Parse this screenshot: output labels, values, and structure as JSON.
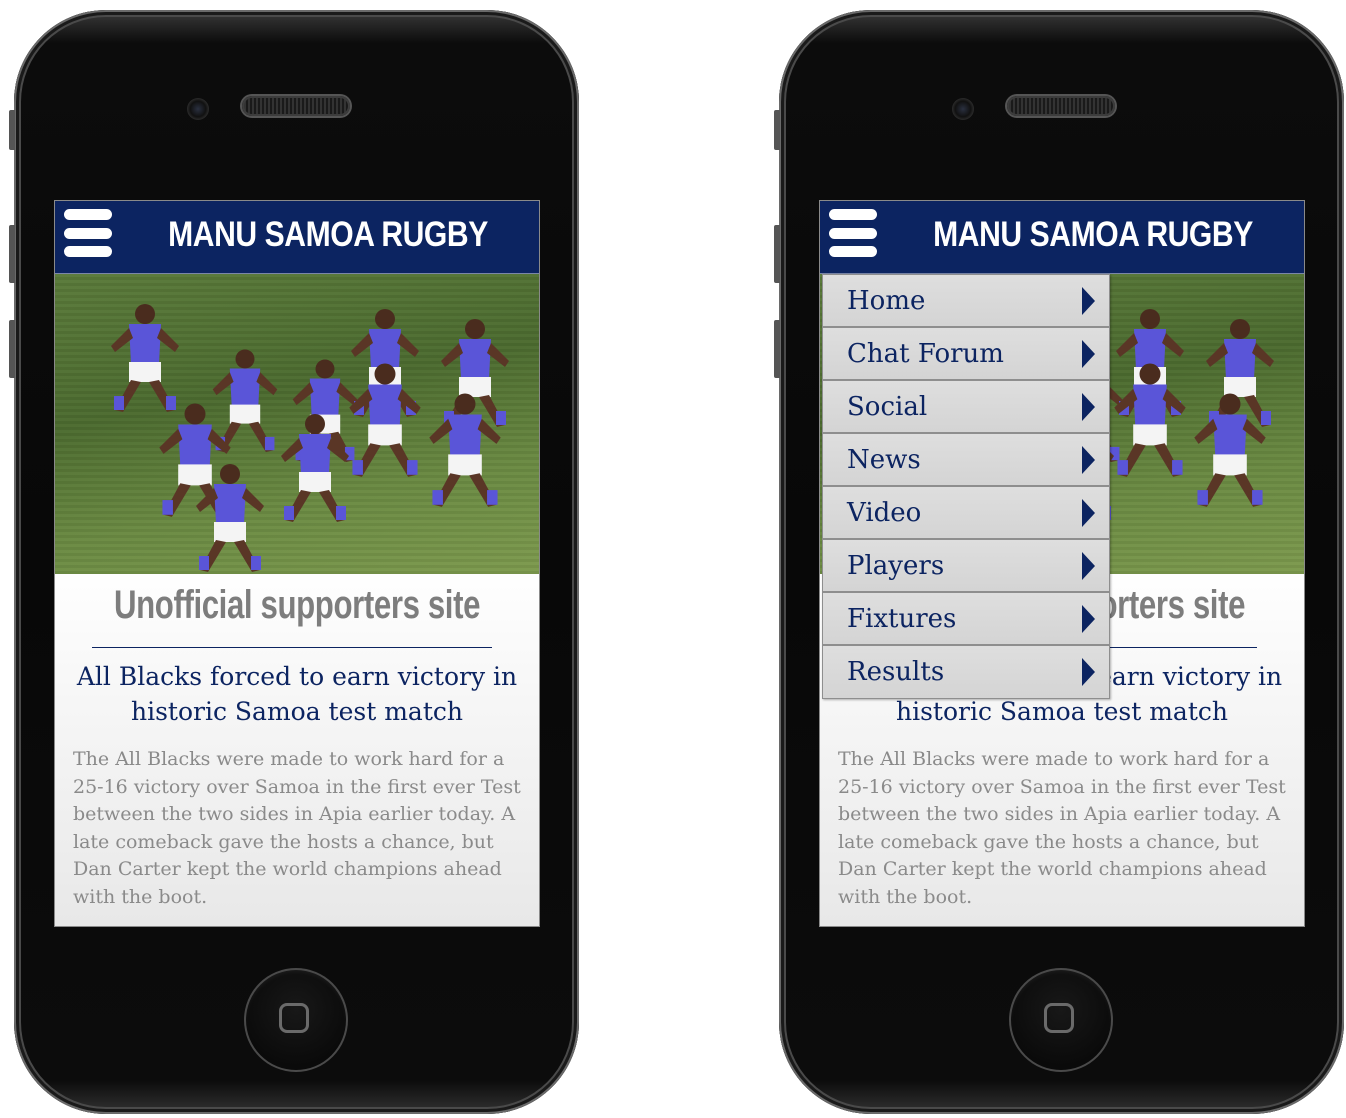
{
  "site": {
    "title": "MANU SAMOA RUGBY",
    "tagline": "Unofficial supporters site"
  },
  "article": {
    "headline": "All Blacks forced to earn victory in historic Samoa test match",
    "body": "The All Blacks were made to work hard for a 25-16 victory over Samoa in the first ever Test between the two sides in Apia earlier today. A late comeback gave the hosts a chance, but Dan Carter kept the world champions ahead with the boot."
  },
  "menu": {
    "items": [
      {
        "label": "Home"
      },
      {
        "label": "Chat Forum"
      },
      {
        "label": "Social"
      },
      {
        "label": "News"
      },
      {
        "label": "Video"
      },
      {
        "label": "Players"
      },
      {
        "label": "Fixtures"
      },
      {
        "label": "Results"
      }
    ]
  },
  "colors": {
    "header_bg": "#0c2461",
    "title_text": "#ffffff",
    "tagline_text": "#7d7d7d",
    "headline_text": "#0c2461",
    "body_text": "#8a8a8a",
    "menu_bg": "#d8d8d8",
    "jersey": "#5a55d8"
  },
  "icons": {
    "menu_toggle": "hamburger-icon",
    "menu_item_arrow": "caret-right-icon",
    "home_button": "home-square-icon"
  }
}
